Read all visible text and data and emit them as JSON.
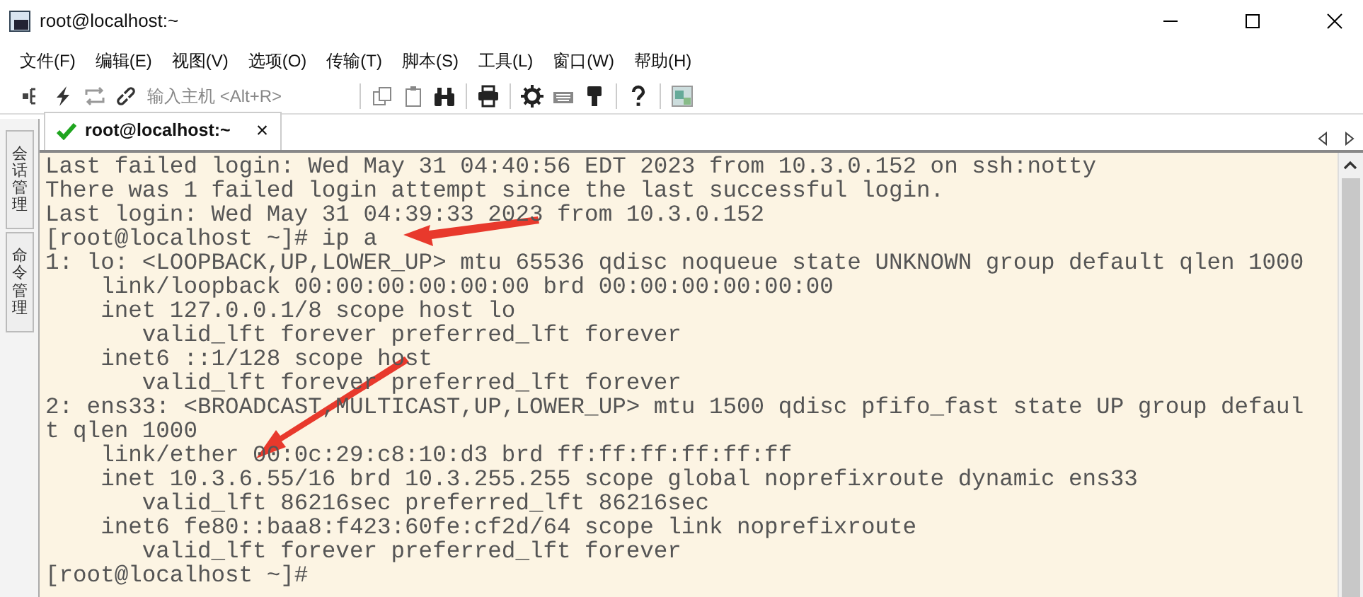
{
  "window": {
    "title": "root@localhost:~"
  },
  "menu": [
    "文件(F)",
    "编辑(E)",
    "视图(V)",
    "选项(O)",
    "传输(T)",
    "脚本(S)",
    "工具(L)",
    "窗口(W)",
    "帮助(H)"
  ],
  "toolbar": {
    "host_field": {
      "placeholder": "输入主机 <Alt+R>"
    }
  },
  "side_tabs": [
    {
      "label": "会话管理"
    },
    {
      "label": "命令管理"
    }
  ],
  "tabs": [
    {
      "label": "root@localhost:~",
      "selected": true,
      "connected": true,
      "close": "×"
    }
  ],
  "terminal": {
    "lines": [
      "Last failed login: Wed May 31 04:40:56 EDT 2023 from 10.3.0.152 on ssh:notty",
      "There was 1 failed login attempt since the last successful login.",
      "Last login: Wed May 31 04:39:33 2023 from 10.3.0.152",
      "[root@localhost ~]# ip a",
      "1: lo: <LOOPBACK,UP,LOWER_UP> mtu 65536 qdisc noqueue state UNKNOWN group default qlen 1000",
      "    link/loopback 00:00:00:00:00:00 brd 00:00:00:00:00:00",
      "    inet 127.0.0.1/8 scope host lo",
      "       valid_lft forever preferred_lft forever",
      "    inet6 ::1/128 scope host",
      "       valid_lft forever preferred_lft forever",
      "2: ens33: <BROADCAST,MULTICAST,UP,LOWER_UP> mtu 1500 qdisc pfifo_fast state UP group defaul",
      "t qlen 1000",
      "    link/ether 00:0c:29:c8:10:d3 brd ff:ff:ff:ff:ff:ff",
      "    inet 10.3.6.55/16 brd 10.3.255.255 scope global noprefixroute dynamic ens33",
      "       valid_lft 86216sec preferred_lft 86216sec",
      "    inet6 fe80::baa8:f423:60fe:cf2d/64 scope link noprefixroute",
      "       valid_lft forever preferred_lft forever",
      "[root@localhost ~]#"
    ]
  }
}
